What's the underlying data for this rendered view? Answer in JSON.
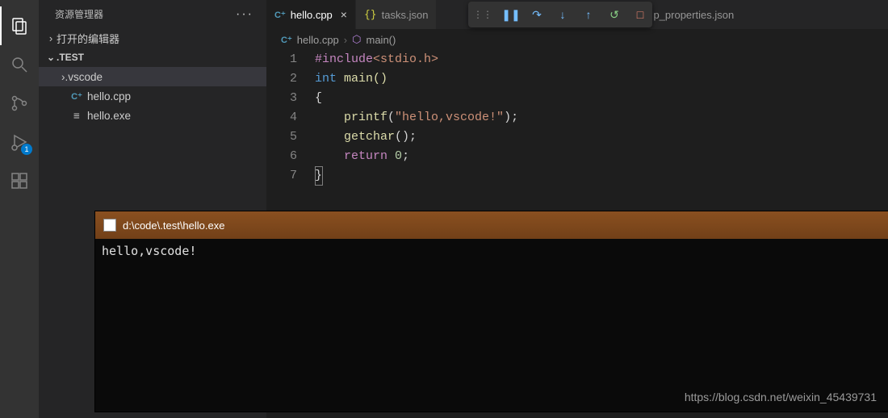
{
  "sidebar": {
    "title": "资源管理器",
    "sections": {
      "openEditors": "打开的编辑器",
      "folder": ".TEST"
    },
    "tree": {
      "vscodeFolder": ".vscode",
      "file1": "hello.cpp",
      "file2": "hello.exe"
    }
  },
  "activity": {
    "debugBadge": "1"
  },
  "tabs": {
    "t1": "hello.cpp",
    "t2": "tasks.json",
    "t3": "p_properties.json"
  },
  "breadcrumb": {
    "file": "hello.cpp",
    "symbol": "main()"
  },
  "code": {
    "lines": [
      "1",
      "2",
      "3",
      "4",
      "5",
      "6",
      "7"
    ],
    "l1a": "#include",
    "l1b": "<stdio.h>",
    "l2a": "int",
    "l2b": " main()",
    "l3": "{",
    "l4a": "    printf",
    "l4b": "(",
    "l4c": "\"hello,vscode!\"",
    "l4d": ");",
    "l5a": "    getchar",
    "l5b": "();",
    "l6a": "    ",
    "l6b": "return",
    "l6c": " ",
    "l6d": "0",
    "l6e": ";",
    "l7": "}"
  },
  "console": {
    "title": "d:\\code\\.test\\hello.exe",
    "output": "hello,vscode!"
  },
  "watermark": "https://blog.csdn.net/weixin_45439731"
}
